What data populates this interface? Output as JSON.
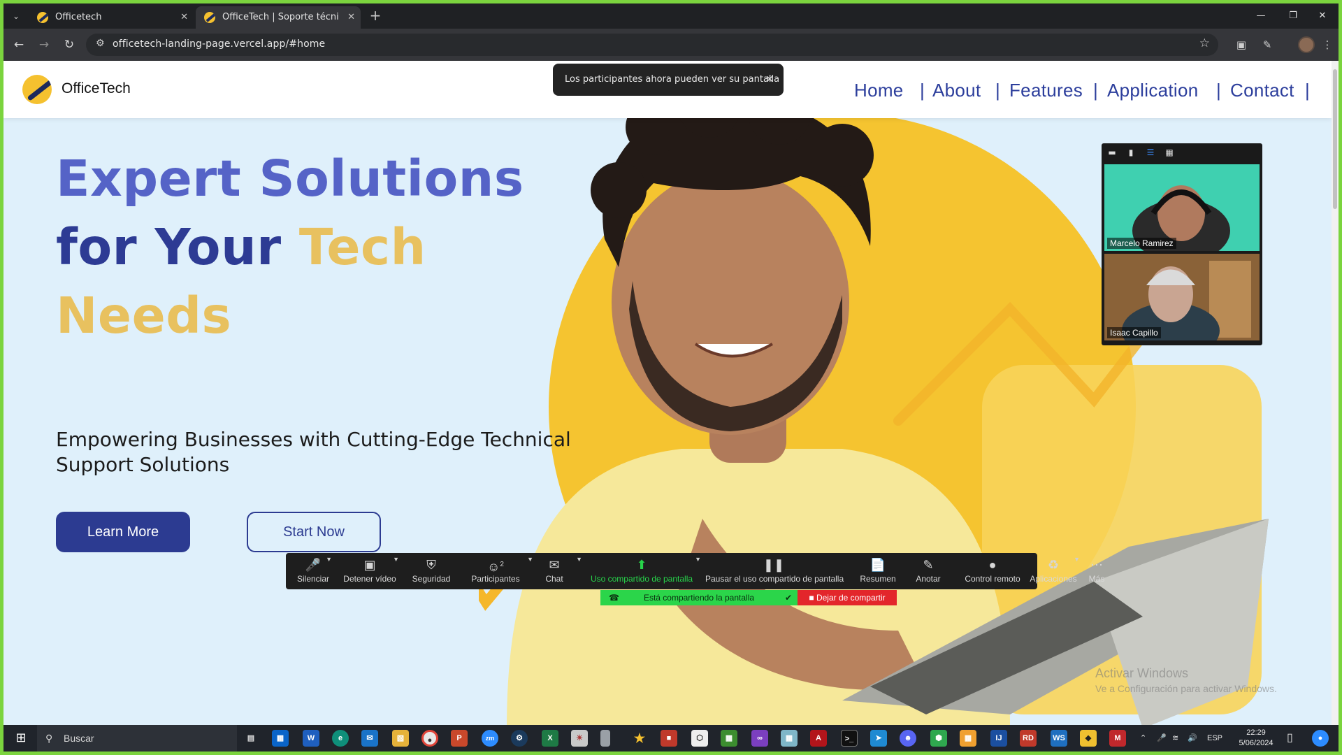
{
  "browser": {
    "tabs": [
      {
        "title": "Officetech",
        "active": false
      },
      {
        "title": "OfficeTech | Soporte técnico a t",
        "active": true
      }
    ],
    "url": "officetech-landing-page.vercel.app/#home"
  },
  "site": {
    "brand": "OfficeTech",
    "nav": [
      "Home",
      "About",
      "Features",
      "Application",
      "Contact"
    ],
    "nav_separator": "|",
    "hero": {
      "title_part1": "Expert Solutions",
      "title_part2": "for Your",
      "title_highlight": "Tech",
      "title_part3": "Needs",
      "subtitle": "Empowering Businesses with Cutting-Edge Technical Support Solutions",
      "primary_button": "Learn More",
      "secondary_button": "Start Now"
    },
    "colors": {
      "accent": "#2c3b91",
      "title_blue": "#5563c7",
      "gold": "#e8c15f",
      "hero_bg": "#dff0fb"
    }
  },
  "zoom": {
    "toast": "Los participantes ahora pueden ver su pantalla",
    "participants": [
      {
        "name": "Marcelo Ramirez"
      },
      {
        "name": "Isaac Capillo"
      }
    ],
    "toolbar": [
      {
        "label": "Silenciar",
        "icon": "microphone-icon"
      },
      {
        "label": "Detener vídeo",
        "icon": "video-camera-icon"
      },
      {
        "label": "Seguridad",
        "icon": "shield-icon"
      },
      {
        "label": "Participantes",
        "icon": "participants-icon",
        "count": "2"
      },
      {
        "label": "Chat",
        "icon": "chat-icon"
      },
      {
        "label": "Uso compartido de pantalla",
        "icon": "share-screen-icon"
      },
      {
        "label": "Pausar el uso compartido de pantalla",
        "icon": "pause-icon"
      },
      {
        "label": "Resumen",
        "icon": "summary-icon"
      },
      {
        "label": "Anotar",
        "icon": "pencil-icon"
      },
      {
        "label": "Control remoto",
        "icon": "mouse-icon"
      },
      {
        "label": "Aplicaciones",
        "icon": "apps-icon"
      },
      {
        "label": "Más",
        "icon": "more-icon"
      }
    ],
    "sharing_status": "Está compartiendo la pantalla",
    "stop_share": "Dejar de compartir"
  },
  "windows": {
    "activation_title": "Activar Windows",
    "activation_sub": "Ve a Configuración para activar Windows.",
    "search_placeholder": "Buscar",
    "language": "ESP",
    "time": "22:29",
    "date": "5/06/2024"
  }
}
